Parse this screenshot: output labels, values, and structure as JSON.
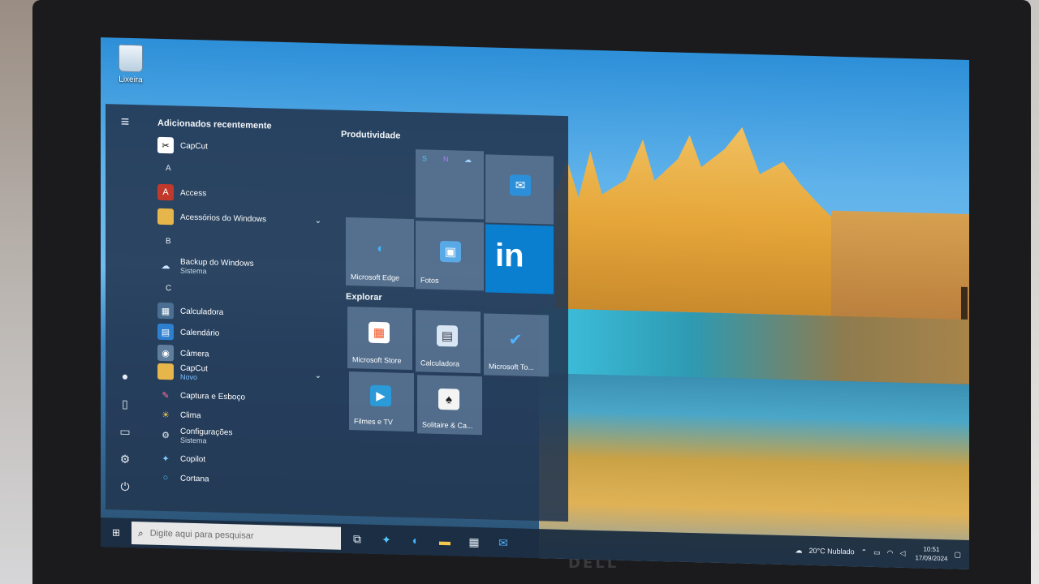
{
  "desktop": {
    "recycle_bin_label": "Lixeira"
  },
  "start_menu": {
    "recent_header": "Adicionados recentemente",
    "apps": [
      {
        "label": "CapCut",
        "icon": "capcut-icon"
      },
      {
        "letter": "A"
      },
      {
        "label": "Access",
        "icon": "access-icon",
        "color": "#c0392b"
      },
      {
        "label": "Acessórios do Windows",
        "icon": "folder-icon",
        "expandable": true
      },
      {
        "letter": "B"
      },
      {
        "label": "Backup do Windows",
        "sub": "Sistema",
        "icon": "cloud-icon"
      },
      {
        "letter": "C"
      },
      {
        "label": "Calculadora",
        "icon": "calculator-icon"
      },
      {
        "label": "Calendário",
        "icon": "calendar-icon"
      },
      {
        "label": "Câmera",
        "icon": "camera-icon"
      },
      {
        "label": "CapCut",
        "sub": "Novo",
        "icon": "folder-icon",
        "expandable": true
      },
      {
        "label": "Captura e Esboço",
        "icon": "snip-icon"
      },
      {
        "label": "Clima",
        "icon": "weather-icon"
      },
      {
        "label": "Configurações",
        "sub": "Sistema",
        "icon": "gear-icon"
      },
      {
        "label": "Copilot",
        "icon": "copilot-icon"
      },
      {
        "label": "Cortana",
        "icon": "cortana-icon"
      }
    ],
    "groups": {
      "productivity": "Produtividade",
      "explore": "Explorar"
    },
    "tiles": {
      "edge": "Microsoft Edge",
      "photos": "Fotos",
      "store": "Microsoft Store",
      "calculator": "Calculadora",
      "todo": "Microsoft To...",
      "movies": "Filmes e TV",
      "solitaire": "Solitaire & Ca..."
    },
    "colors": {
      "linkedin": "#0a7fd0",
      "accent": "#1a7fd8"
    }
  },
  "taskbar": {
    "search_placeholder": "Digite aqui para pesquisar",
    "weather": "20°C  Nublado",
    "time": "10:51",
    "date": "17/09/2024"
  },
  "hardware": {
    "brand": "DELL"
  }
}
